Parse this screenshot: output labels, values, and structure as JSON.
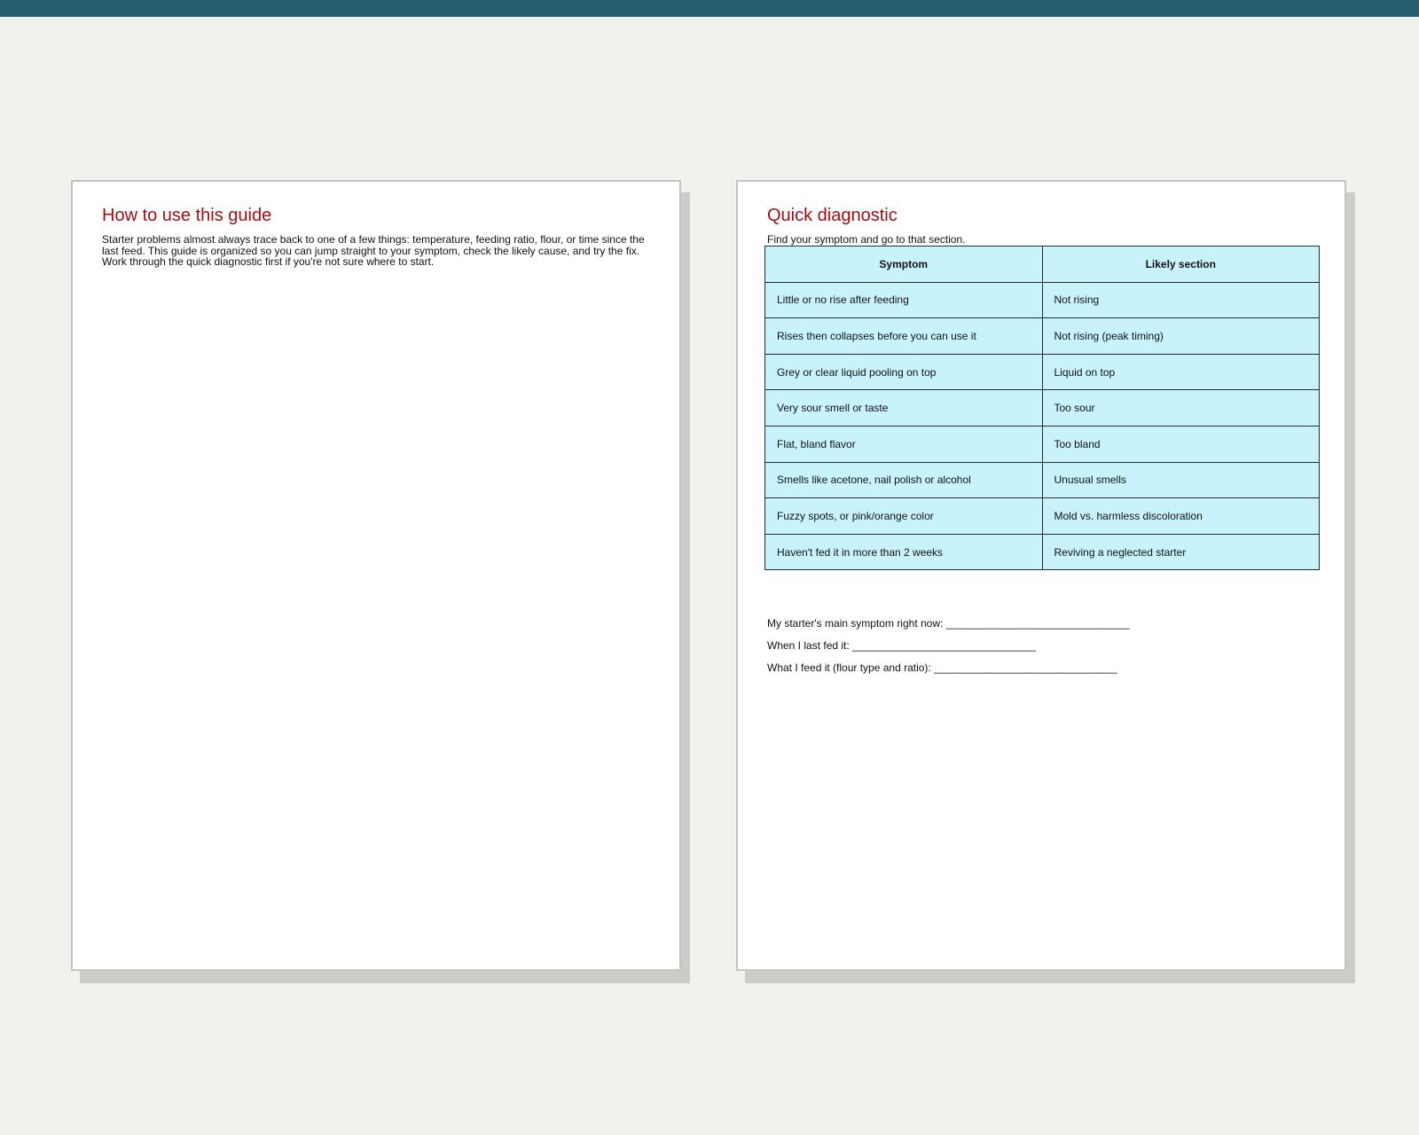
{
  "page_left": {
    "title": "How to use this guide",
    "body": "Starter problems almost always trace back to one of a few things: temperature, feeding ratio, flour, or time since the last feed. This guide is organized so you can jump straight to your symptom, check the likely cause, and try the fix. Work through the quick diagnostic first if you're not sure where to start."
  },
  "page_right": {
    "title": "Quick diagnostic",
    "subtitle": "Find your symptom and go to that section.",
    "table": {
      "headers": [
        "Symptom",
        "Likely section"
      ],
      "rows": [
        [
          "Little or no rise after feeding",
          "Not rising"
        ],
        [
          "Rises then collapses before you can use it",
          "Not rising (peak timing)"
        ],
        [
          "Grey or clear liquid pooling on top",
          "Liquid on top"
        ],
        [
          "Very sour smell or taste",
          "Too sour"
        ],
        [
          "Flat, bland flavor",
          "Too bland"
        ],
        [
          "Smells like acetone, nail polish or alcohol",
          "Unusual smells"
        ],
        [
          "Fuzzy spots, or pink/orange color",
          "Mold vs. harmless discoloration"
        ],
        [
          "Haven't fed it in more than 2 weeks",
          "Reviving a neglected starter"
        ]
      ]
    },
    "notes": [
      "My starter's main symptom right now: _______________________________",
      "When I last fed it: _______________________________",
      "What I feed it (flour type and ratio): _______________________________"
    ]
  },
  "colors": {
    "topbar": "#255f6f",
    "heading": "#a30d12",
    "table_cell": "#c8f2fc",
    "background": "#f2f1ed"
  }
}
